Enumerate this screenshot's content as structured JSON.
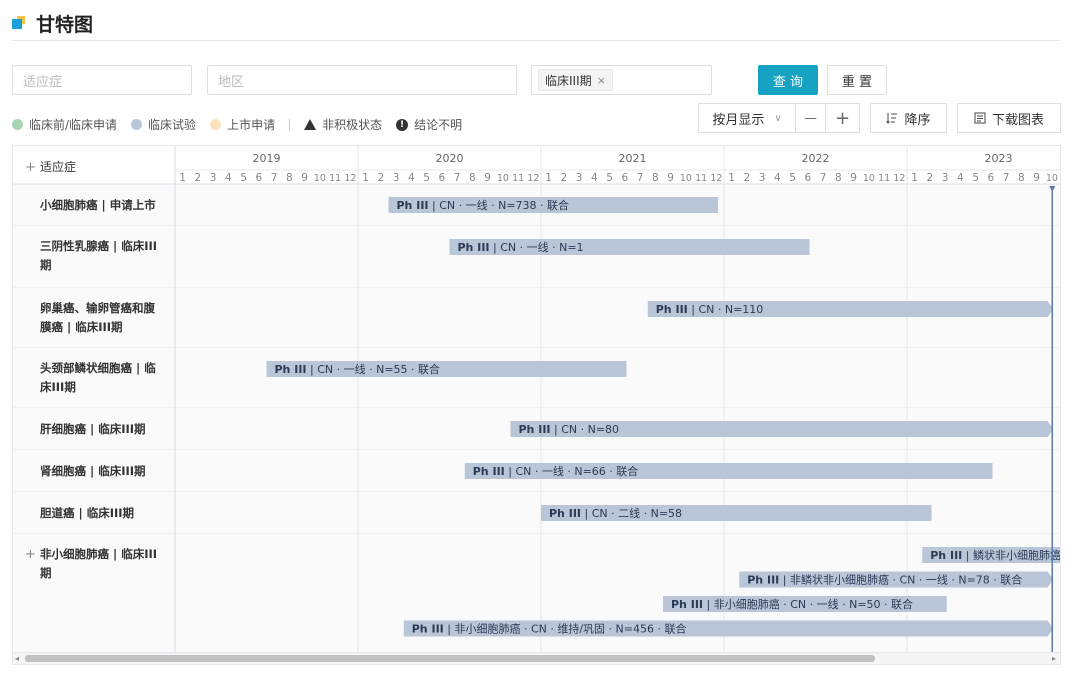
{
  "page_title": "甘特图",
  "filters": {
    "indication_placeholder": "适应症",
    "region_placeholder": "地区",
    "phase_tag": "临床III期",
    "phase_tag_close": "×"
  },
  "buttons": {
    "query": "查 询",
    "reset": "重 置"
  },
  "legend": [
    {
      "label": "临床前/临床申请",
      "color": "#a9d5b5"
    },
    {
      "label": "临床试验",
      "color": "#b9c6d8"
    },
    {
      "label": "上市申请",
      "color": "#fbe3c0"
    }
  ],
  "legend_markers": {
    "inactive": "非积极状态",
    "unclear": "结论不明",
    "unclear_glyph": "!"
  },
  "controls": {
    "view_mode": "按月显示",
    "view_caret": "∨",
    "zoom_out": "—",
    "zoom_in": "+",
    "sort": "降序",
    "download": "下载图表"
  },
  "grid": {
    "header_label": "适应症",
    "expand_glyph": "+",
    "years": [
      "2019",
      "2020",
      "2021",
      "2022",
      "2023"
    ],
    "month_labels": [
      "1",
      "2",
      "3",
      "4",
      "5",
      "6",
      "7",
      "8",
      "9",
      "10",
      "11",
      "12"
    ],
    "start": "2019-01",
    "today_month": 10
  },
  "rows": [
    {
      "label_lines": [
        "小细胞肺癌 | 申请上市"
      ],
      "expand": false,
      "bars": [
        {
          "start": "2020-03",
          "end": "2021-12",
          "phase": "Ph III",
          "details": [
            "CN",
            "一线",
            "N=738",
            "联合"
          ],
          "arrow": false
        }
      ]
    },
    {
      "label_lines": [
        "三阴性乳腺癌 | 临床III",
        "期"
      ],
      "expand": false,
      "bars": [
        {
          "start": "2020-07",
          "end": "2022-06",
          "phase": "Ph III",
          "details": [
            "CN",
            "一线",
            "N=1"
          ],
          "arrow": false
        }
      ]
    },
    {
      "label_lines": [
        "卵巢癌、输卵管癌和腹",
        "膜癌 | 临床III期"
      ],
      "expand": false,
      "bars": [
        {
          "start": "2021-08",
          "end": "2023-10",
          "phase": "Ph III",
          "details": [
            "CN",
            "N=110"
          ],
          "arrow": true
        }
      ]
    },
    {
      "label_lines": [
        "头颈部鳞状细胞癌 | 临",
        "床III期"
      ],
      "expand": false,
      "bars": [
        {
          "start": "2019-07",
          "end": "2021-06",
          "phase": "Ph III",
          "details": [
            "CN",
            "一线",
            "N=55",
            "联合"
          ],
          "arrow": false
        }
      ]
    },
    {
      "label_lines": [
        "肝细胞癌 | 临床III期"
      ],
      "expand": false,
      "bars": [
        {
          "start": "2020-11",
          "end": "2023-10",
          "phase": "Ph III",
          "details": [
            "CN",
            "N=80"
          ],
          "arrow": true
        }
      ]
    },
    {
      "label_lines": [
        "肾细胞癌 | 临床III期"
      ],
      "expand": false,
      "bars": [
        {
          "start": "2020-08",
          "end": "2023-06",
          "phase": "Ph III",
          "details": [
            "CN",
            "一线",
            "N=66",
            "联合"
          ],
          "arrow": false
        }
      ]
    },
    {
      "label_lines": [
        "胆道癌 | 临床III期"
      ],
      "expand": false,
      "bars": [
        {
          "start": "2021-01",
          "end": "2023-02",
          "phase": "Ph III",
          "details": [
            "CN",
            "二线",
            "N=58"
          ],
          "arrow": false
        }
      ]
    },
    {
      "label_lines": [
        "非小细胞肺癌 | 临床III",
        "期"
      ],
      "expand": true,
      "bars": [
        {
          "start": "2023-02",
          "end": "2023-10",
          "phase": "Ph III",
          "details": [
            "鳞状非小细胞肺癌"
          ],
          "arrow": false,
          "clip": true
        },
        {
          "start": "2022-02",
          "end": "2023-10",
          "phase": "Ph III",
          "details": [
            "非鳞状非小细胞肺癌",
            "CN",
            "一线",
            "N=78",
            "联合"
          ],
          "arrow": true
        },
        {
          "start": "2021-09",
          "end": "2023-03",
          "phase": "Ph III",
          "details": [
            "非小细胞肺癌",
            "CN",
            "一线",
            "N=50",
            "联合"
          ],
          "arrow": false
        },
        {
          "start": "2020-04",
          "end": "2023-10",
          "phase": "Ph III",
          "details": [
            "非小细胞肺癌",
            "CN",
            "维持/巩固",
            "N=456",
            "联合"
          ],
          "arrow": true
        }
      ]
    }
  ],
  "scrollbar": {
    "left_arrow": "◂",
    "right_arrow": "▸"
  }
}
